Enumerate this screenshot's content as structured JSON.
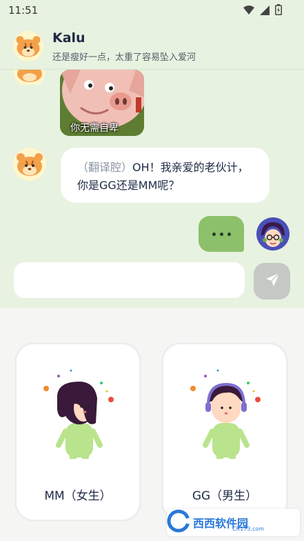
{
  "status_bar": {
    "time": "11:51",
    "icons": [
      "wifi-icon",
      "signal-icon",
      "battery-icon"
    ]
  },
  "header": {
    "title": "Kalu",
    "subtitle": "还是瘦好一点，太重了容易坠入爱河",
    "avatar": "tiger-avatar-icon"
  },
  "messages": {
    "sticker_caption": "你无需自卑",
    "bot_tag": "（翻译腔）",
    "bot_text": "OH！我亲爱的老伙计，你是GG还是MM呢？",
    "typing_indicator": "typing-dots"
  },
  "composer": {
    "value": "",
    "send_icon": "paper-plane-icon"
  },
  "gender_options": [
    {
      "label": "MM（女生）"
    },
    {
      "label": "GG（男生）"
    }
  ],
  "watermark": {
    "text": "西西软件园",
    "sub": "CR173.com"
  },
  "colors": {
    "chat_bg": "#e7f2e0",
    "user_bubble": "#8dc06b",
    "bot_bubble": "#ffffff",
    "send_button_disabled": "#c5c9c6",
    "title": "#1f2a44"
  }
}
